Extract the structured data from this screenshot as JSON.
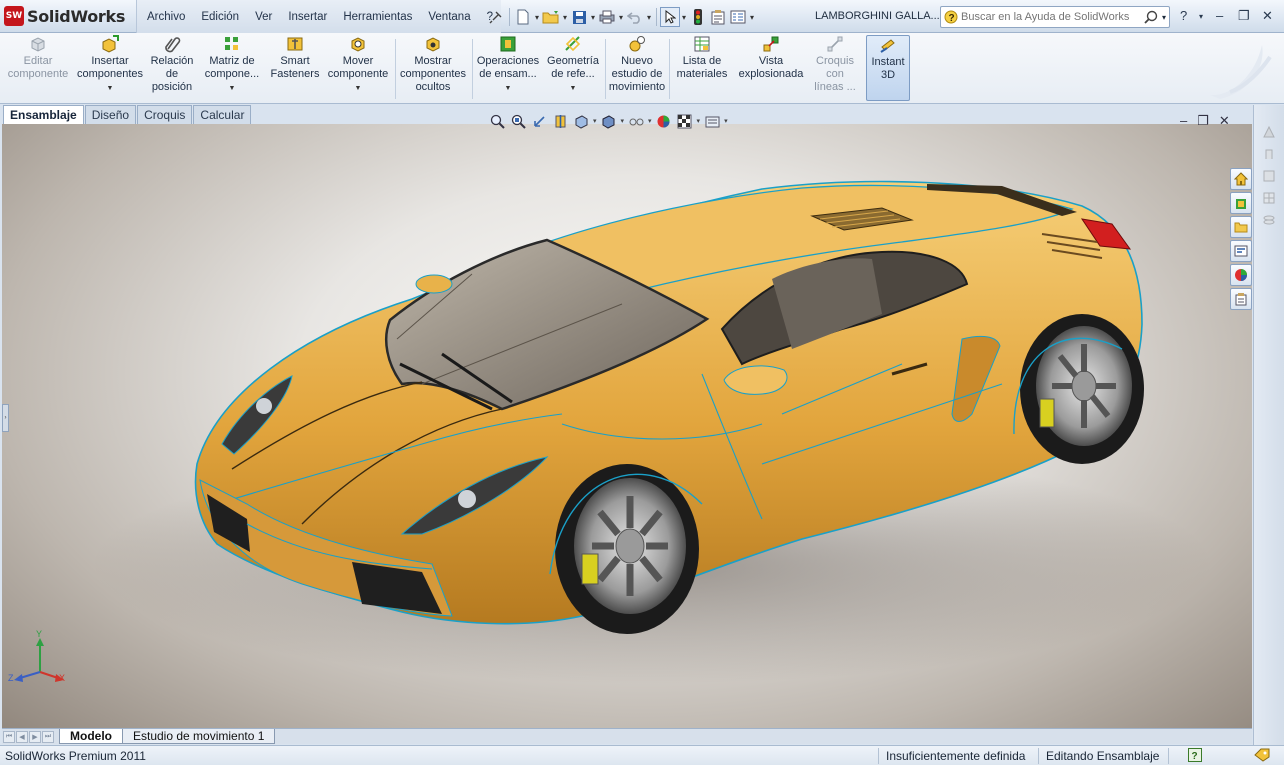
{
  "app": {
    "brand": "SolidWorks",
    "badge": "SW",
    "document_title": "LAMBORGHINI GALLA...",
    "status_product": "SolidWorks Premium 2011"
  },
  "menu": [
    "Archivo",
    "Edición",
    "Ver",
    "Insertar",
    "Herramientas",
    "Ventana",
    "?"
  ],
  "help_search": {
    "placeholder": "Buscar en la Ayuda de SolidWorks"
  },
  "ribbon": {
    "editar": "Editar componente",
    "insertar": "Insertar componentes",
    "relacion": "Relación de posición",
    "matriz": "Matriz de compone...",
    "smart": "Smart Fasteners",
    "mover": "Mover componente",
    "mostrar": "Mostrar componentes ocultos",
    "operaciones": "Operaciones de ensam...",
    "geometria": "Geometría de refe...",
    "nuevo_estudio": "Nuevo estudio de movimiento",
    "lista": "Lista de materiales",
    "vista": "Vista explosionada",
    "croquis_lineas": "Croquis con líneas ...",
    "instant3d": "Instant 3D"
  },
  "cm_tabs": [
    "Ensamblaje",
    "Diseño",
    "Croquis",
    "Calcular"
  ],
  "cm_active_tab": "Ensamblaje",
  "bottom_tabs": [
    "Modelo",
    "Estudio de movimiento 1"
  ],
  "status": {
    "definition": "Insuficientemente definida",
    "mode": "Editando Ensamblaje"
  },
  "triad": {
    "x": "X",
    "y": "Y",
    "z": "Z"
  },
  "colors": {
    "car_body": "#e2a53d",
    "car_edge": "#1aa0c8",
    "accent_red": "#c4161c",
    "highlight_blue": "#7d9cc4"
  },
  "icons": {
    "search": "magnifier-icon",
    "help": "question-icon",
    "home": "house-icon",
    "folder": "folder-icon"
  }
}
